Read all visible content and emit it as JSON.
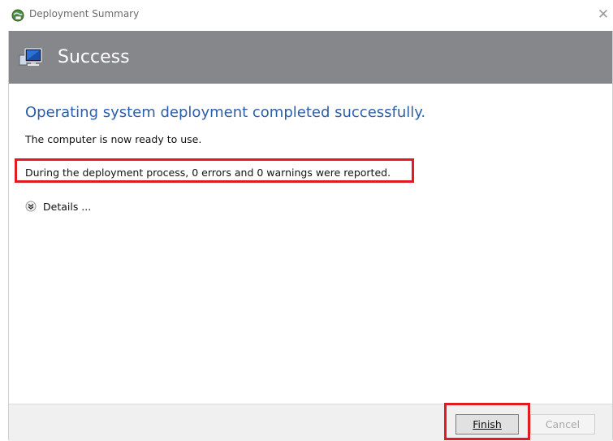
{
  "window": {
    "title": "Deployment Summary",
    "close_glyph": "✕"
  },
  "header": {
    "title": "Success",
    "icon": "computer-monitor-icon"
  },
  "content": {
    "heading": "Operating system deployment completed successfully.",
    "subtext": "The computer is now ready to use.",
    "report": "During the deployment process, 0 errors and 0 warnings were reported.",
    "details_label": "Details ..."
  },
  "footer": {
    "finish_label": "Finish",
    "cancel_label": "Cancel"
  },
  "colors": {
    "banner": "#85878a",
    "heading": "#2b5fa8",
    "highlight": "#e11b22"
  }
}
